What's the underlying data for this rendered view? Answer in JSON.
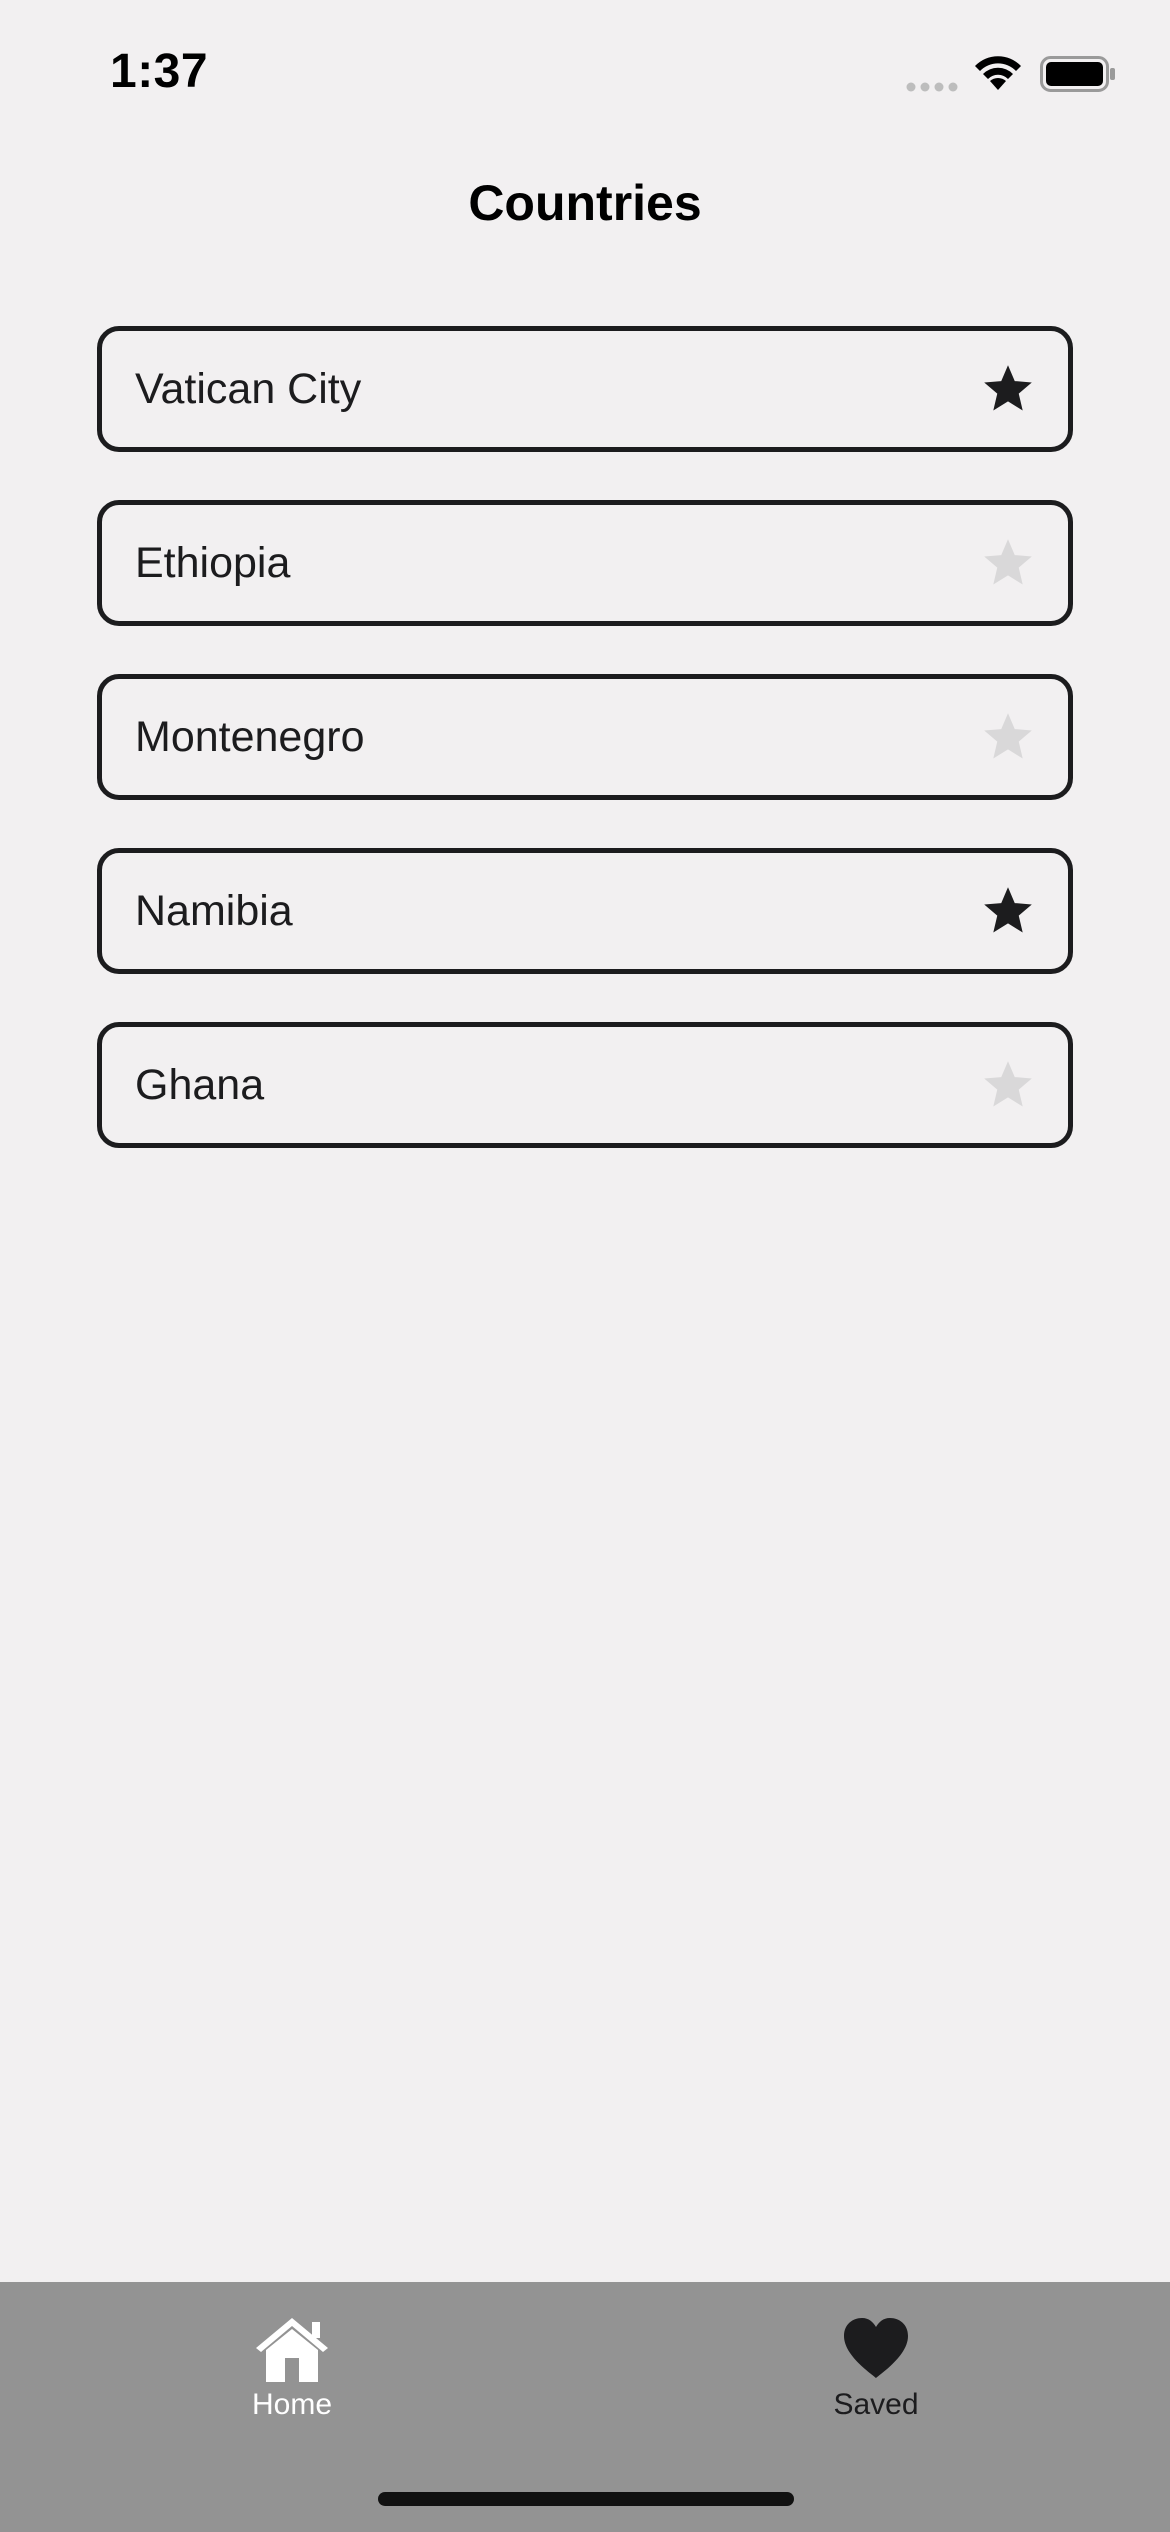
{
  "status_bar": {
    "time": "1:37",
    "icons": [
      "cellular-signal-icon",
      "wifi-icon",
      "battery-icon"
    ]
  },
  "header": {
    "title": "Countries"
  },
  "countries": [
    {
      "name": "Vatican City",
      "favorite": true
    },
    {
      "name": "Ethiopia",
      "favorite": false
    },
    {
      "name": "Montenegro",
      "favorite": false
    },
    {
      "name": "Namibia",
      "favorite": true
    },
    {
      "name": "Ghana",
      "favorite": false
    }
  ],
  "tab_bar": {
    "tabs": [
      {
        "label": "Home",
        "icon": "home-icon",
        "active": true
      },
      {
        "label": "Saved",
        "icon": "heart-icon",
        "active": false
      }
    ]
  },
  "colors": {
    "background": "#f2f0f1",
    "text": "#1c1c1e",
    "star_active": "#1c1c1e",
    "star_inactive": "#d9d8d9",
    "tab_bar": "#939393",
    "tab_active": "#ffffff"
  }
}
